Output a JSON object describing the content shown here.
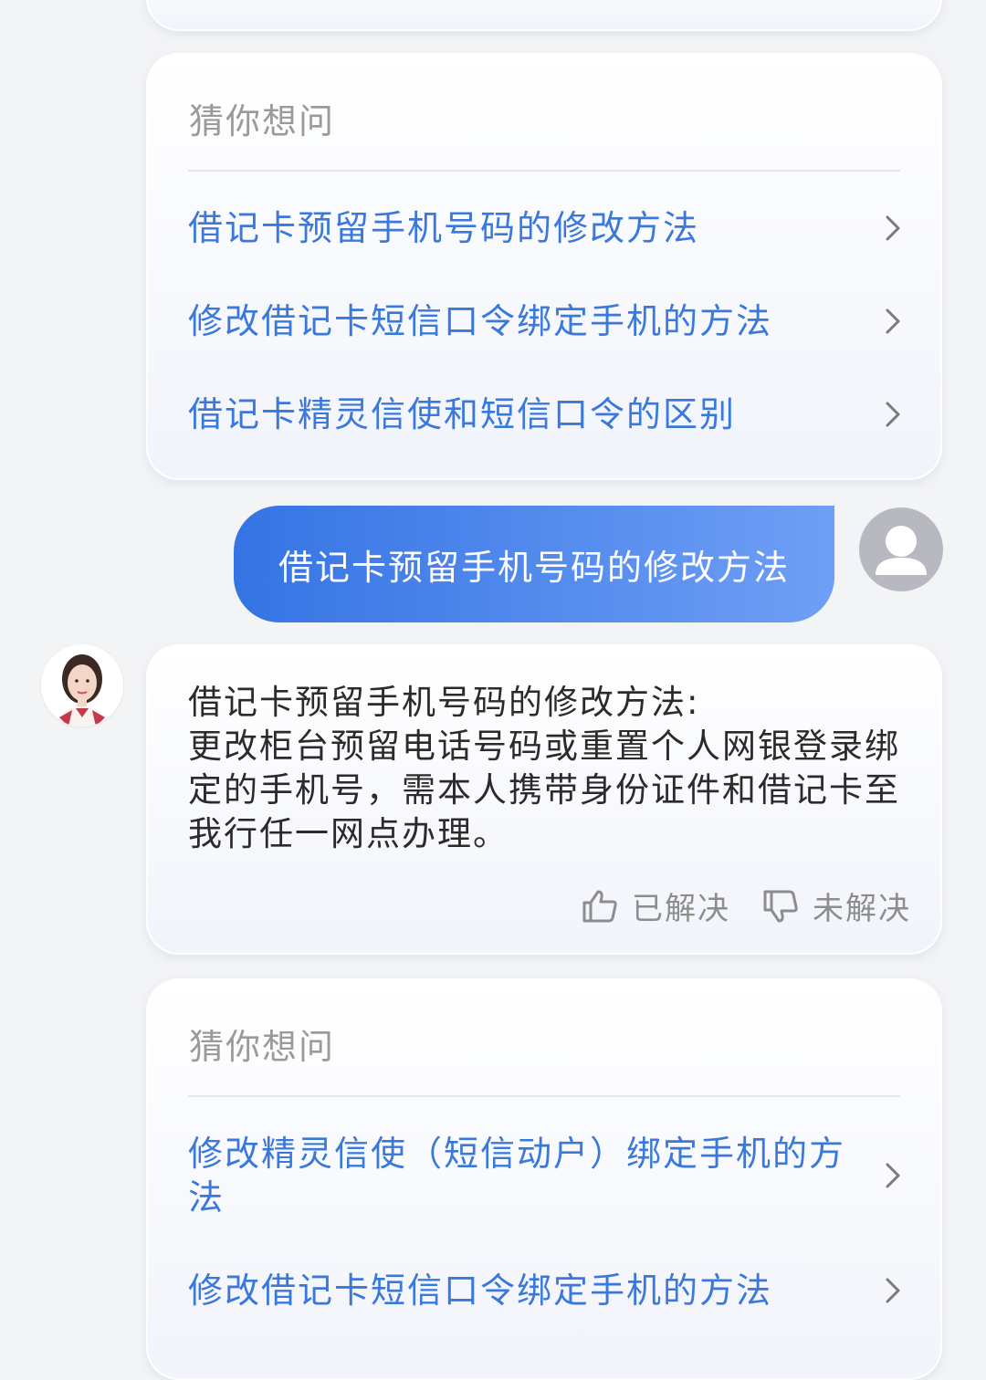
{
  "suggest_block_1": {
    "title": "猜你想问",
    "items": [
      {
        "label": "借记卡预留手机号码的修改方法"
      },
      {
        "label": "修改借记卡短信口令绑定手机的方法"
      },
      {
        "label": "借记卡精灵信使和短信口令的区别"
      }
    ]
  },
  "user_message": {
    "text": "借记卡预留手机号码的修改方法"
  },
  "bot_answer": {
    "title": "借记卡预留手机号码的修改方法:",
    "body": "更改柜台预留电话号码或重置个人网银登录绑定的手机号，需本人携带身份证件和借记卡至我行任一网点办理。",
    "resolved_label": "已解决",
    "unresolved_label": "未解决"
  },
  "suggest_block_2": {
    "title": "猜你想问",
    "items": [
      {
        "label": "修改精灵信使（短信动户）绑定手机的方法"
      },
      {
        "label": "修改借记卡短信口令绑定手机的方法"
      }
    ]
  },
  "colors": {
    "link_blue": "#3a78dc",
    "user_bubble_start": "#3574e4",
    "user_bubble_end": "#6f9ff5",
    "background": "#f3f4f6"
  },
  "icons": [
    "chevron-right-icon",
    "user-avatar-icon",
    "thumbs-up-icon",
    "thumbs-down-icon"
  ]
}
